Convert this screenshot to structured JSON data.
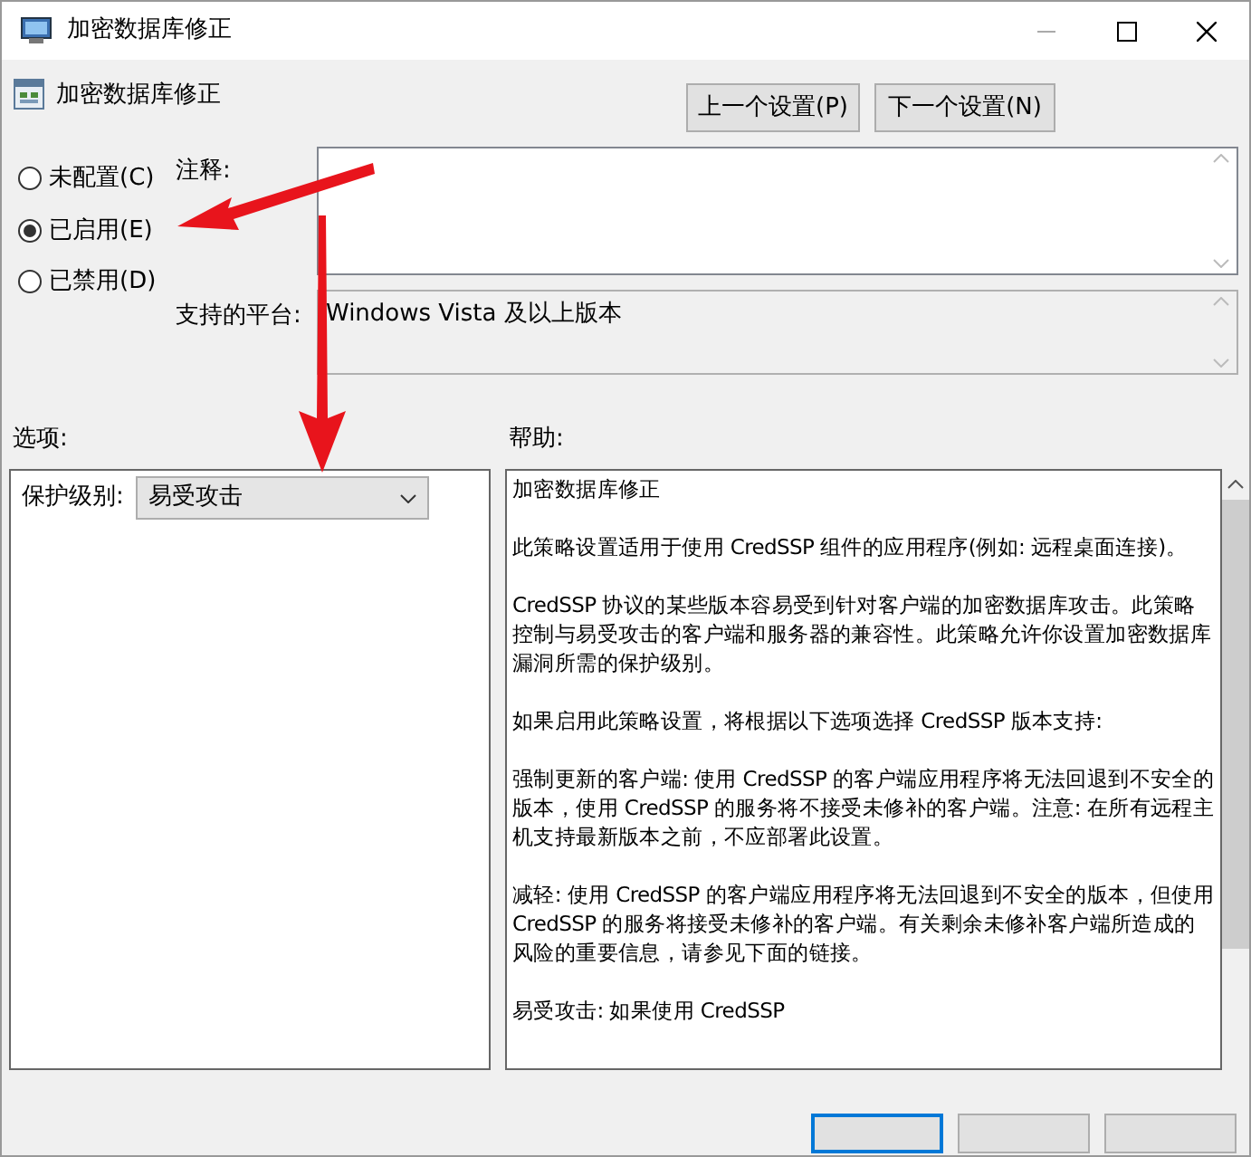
{
  "window": {
    "title": "加密数据库修正"
  },
  "header": {
    "title": "加密数据库修正",
    "buttons": [
      "上一个设置(P)",
      "下一个设置(N)"
    ]
  },
  "state_options": [
    {
      "label": "未配置(C)",
      "selected": false
    },
    {
      "label": "已启用(E)",
      "selected": true
    },
    {
      "label": "已禁用(D)",
      "selected": false
    }
  ],
  "comment": {
    "label": "注释:"
  },
  "platform": {
    "label": "支持的平台:",
    "value": "Windows Vista 及以上版本"
  },
  "options": {
    "label": "选项:",
    "fields": [
      {
        "label": "保护级别:",
        "value": "易受攻击"
      }
    ]
  },
  "help": {
    "label": "帮助:",
    "paragraphs": [
      "加密数据库修正",
      "此策略设置适用于使用 CredSSP 组件的应用程序(例如: 远程桌面连接)。",
      "CredSSP 协议的某些版本容易受到针对客户端的加密数据库攻击。此策略控制与易受攻击的客户端和服务器的兼容性。此策略允许你设置加密数据库漏洞所需的保护级别。",
      "如果启用此策略设置，将根据以下选项选择 CredSSP 版本支持:",
      "强制更新的客户端: 使用 CredSSP 的客户端应用程序将无法回退到不安全的版本，使用 CredSSP 的服务将不接受未修补的客户端。注意: 在所有远程主机支持最新版本之前，不应部署此设置。",
      "减轻: 使用 CredSSP 的客户端应用程序将无法回退到不安全的版本，但使用 CredSSP 的服务将接受未修补的客户端。有关剩余未修补客户端所造成的风险的重要信息，请参见下面的链接。",
      "易受攻击: 如果使用 CredSSP"
    ]
  },
  "footer": {
    "buttons": [
      {
        "default": true
      },
      {
        "default": false
      },
      {
        "default": false
      }
    ]
  }
}
